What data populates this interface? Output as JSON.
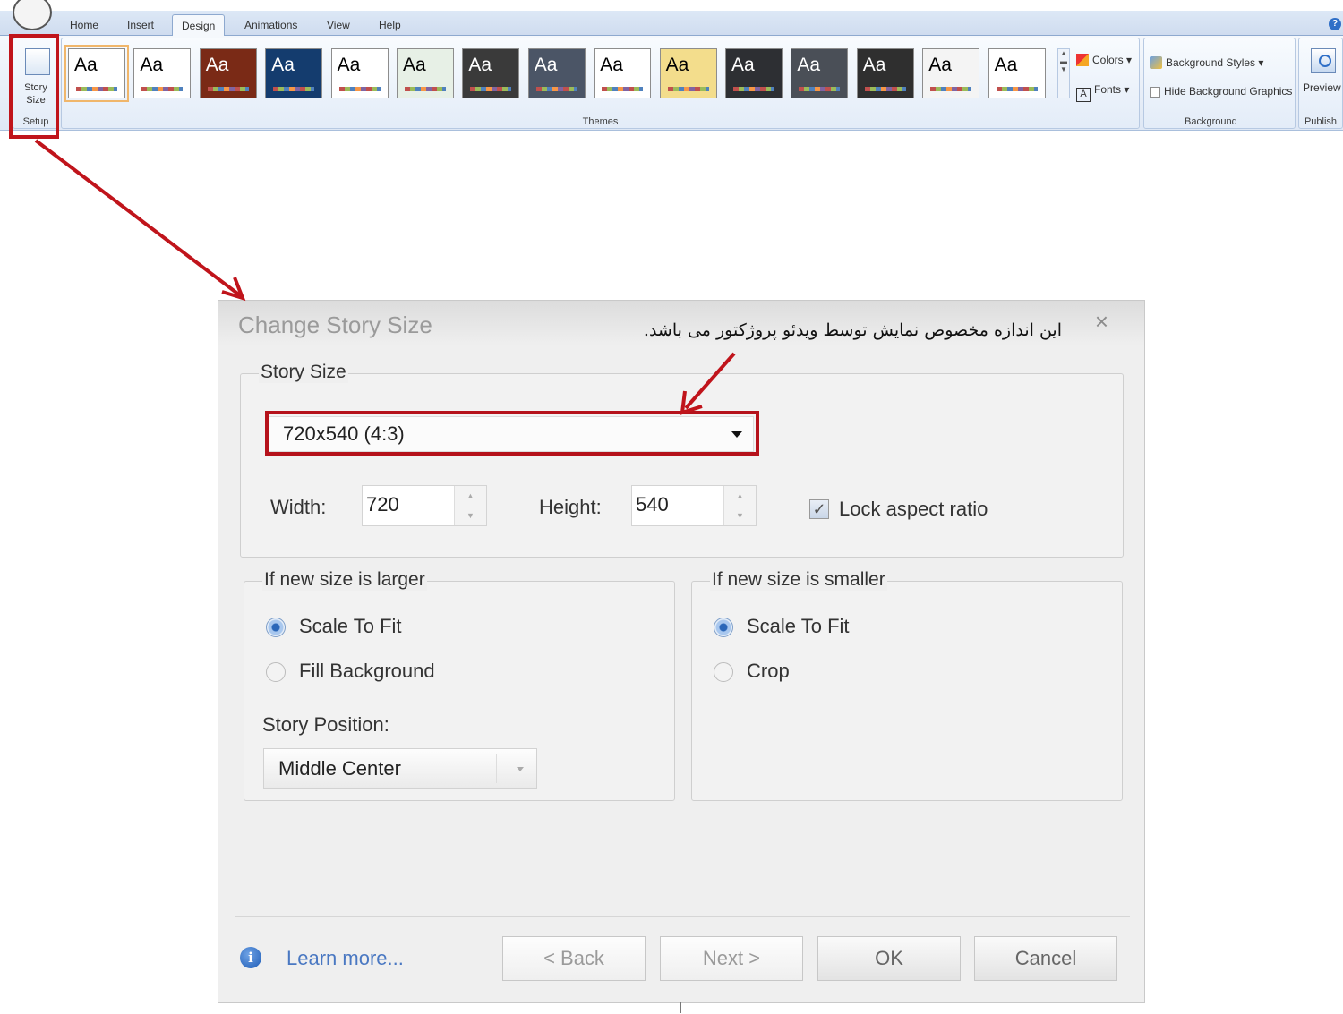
{
  "ribbon": {
    "tabs": [
      {
        "label": "Home"
      },
      {
        "label": "Insert"
      },
      {
        "label": "Design"
      },
      {
        "label": "Animations"
      },
      {
        "label": "View"
      },
      {
        "label": "Help"
      }
    ],
    "active_tab": "Design",
    "setup_group": {
      "button_label_line1": "Story",
      "button_label_line2": "Size",
      "group_label": "Setup"
    },
    "themes_group": {
      "label": "Themes",
      "theme_text": "Aa",
      "theme_backgrounds": [
        "#ffffff",
        "#ffffff",
        "#7a2a16",
        "#143c6e",
        "#ffffff",
        "#e7f0e6",
        "#3a3a3a",
        "#4b5566",
        "#ffffff",
        "#f3dd8c",
        "#2d2f33",
        "#4a4f57",
        "#2f2f2f",
        "#f4f4f4",
        "#ffffff"
      ],
      "theme_text_colors": [
        "#000000",
        "#000000",
        "#ffffff",
        "#ffffff",
        "#000000",
        "#000000",
        "#ffffff",
        "#ffffff",
        "#000000",
        "#000000",
        "#ffffff",
        "#ffffff",
        "#ffffff",
        "#000000",
        "#000000"
      ],
      "colors_label": "Colors",
      "fonts_label": "Fonts"
    },
    "background_group": {
      "styles_label": "Background Styles",
      "hide_label": "Hide Background Graphics",
      "group_label": "Background"
    },
    "publish_group": {
      "preview_label": "Preview",
      "group_label": "Publish"
    }
  },
  "annotation": "این اندازه مخصوص نمایش توسط ویدئو پروژکتور می باشد.",
  "highlight_color": "#c0141b",
  "dialog": {
    "title": "Change Story Size",
    "close": "×",
    "story_size_legend": "Story Size",
    "size_value": "720x540 (4:3)",
    "width_label": "Width:",
    "width_value": "720",
    "height_label": "Height:",
    "height_value": "540",
    "lock_label": "Lock aspect ratio",
    "lock_checked": true,
    "larger": {
      "legend": "If new size is larger",
      "options": [
        "Scale To Fit",
        "Fill Background"
      ],
      "selected": "Scale To Fit",
      "position_label": "Story Position:",
      "position_value": "Middle Center"
    },
    "smaller": {
      "legend": "If new size is smaller",
      "options": [
        "Scale To Fit",
        "Crop"
      ],
      "selected": "Scale To Fit"
    },
    "learn_more": "Learn more...",
    "buttons": {
      "back": "< Back",
      "next": "Next >",
      "ok": "OK",
      "cancel": "Cancel"
    }
  }
}
